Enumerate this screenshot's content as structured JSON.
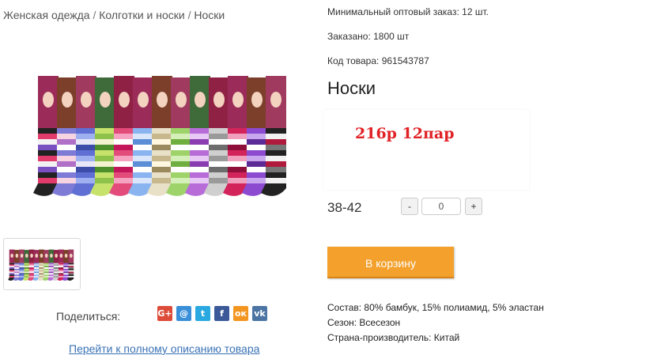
{
  "breadcrumb": {
    "items": [
      "Женская одежда",
      "Колготки и носки",
      "Носки"
    ],
    "separator": "/"
  },
  "info": {
    "min_order": "Минимальный оптовый заказ: 12 шт.",
    "ordered": "Заказано: 1800 шт",
    "product_code": "Код товара: 961543787"
  },
  "product": {
    "title": "Носки",
    "price_note": "216р 12пар",
    "size": "38-42",
    "quantity": "0",
    "minus_label": "-",
    "plus_label": "+",
    "cart_label": "В корзину"
  },
  "share": {
    "label": "Поделиться:",
    "icons": [
      {
        "name": "google-plus-icon",
        "glyph": "G+",
        "color": "#dd4b39"
      },
      {
        "name": "email-icon",
        "glyph": "@",
        "color": "#3a8fd9"
      },
      {
        "name": "twitter-icon",
        "glyph": "t",
        "color": "#2aa9e0"
      },
      {
        "name": "facebook-icon",
        "glyph": "f",
        "color": "#3b5998"
      },
      {
        "name": "odnoklassniki-icon",
        "glyph": "ок",
        "color": "#f39621"
      },
      {
        "name": "vk-icon",
        "glyph": "vk",
        "color": "#4c75a3"
      }
    ]
  },
  "full_description_link": "Перейти к полному описанию товара",
  "specs": {
    "composition": "Состав: 80% бамбук, 15% полиамид, 5% эластан",
    "season": "Сезон: Всесезон",
    "country": "Страна-производитель: Китай"
  },
  "colors": {
    "price": "#e02226",
    "cart_button": "#f3a02c",
    "link": "#3a72b5"
  }
}
